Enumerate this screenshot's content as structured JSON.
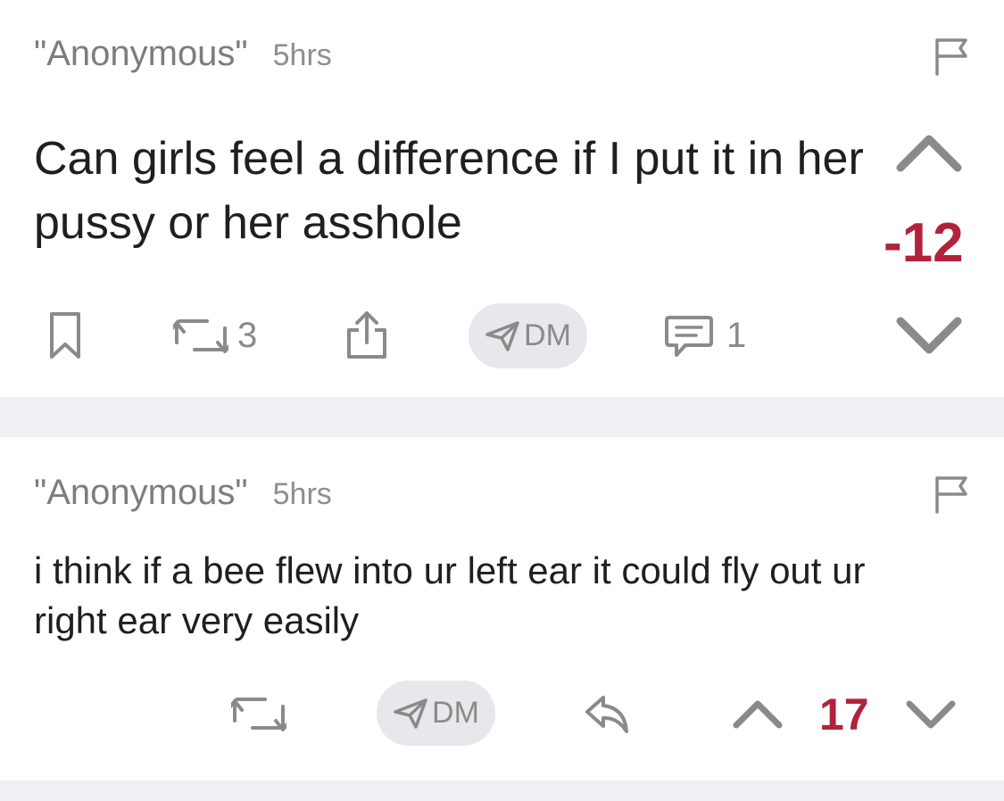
{
  "posts": [
    {
      "author": "\"Anonymous\"",
      "time": "5hrs",
      "text": "Can girls feel a difference if I put it in her pussy or her asshole",
      "score": "-12",
      "repost_count": "3",
      "comment_count": "1",
      "dm_label": "DM"
    },
    {
      "author": "\"Anonymous\"",
      "time": "5hrs",
      "text": "i think if a bee flew into ur left ear it could fly out ur right ear very easily",
      "score": "17",
      "dm_label": "DM"
    }
  ],
  "colors": {
    "score": "#b2223a",
    "icon": "#8a8a8a",
    "divider": "#efeff4",
    "pill": "#e8e8ec"
  },
  "icons": {
    "flag": "flag-icon",
    "bookmark": "bookmark-icon",
    "repost": "repost-icon",
    "share": "share-icon",
    "dm": "paper-plane-icon",
    "comment": "comment-bubble-icon",
    "upvote": "chevron-up-icon",
    "downvote": "chevron-down-icon",
    "reply": "reply-arrow-icon"
  }
}
